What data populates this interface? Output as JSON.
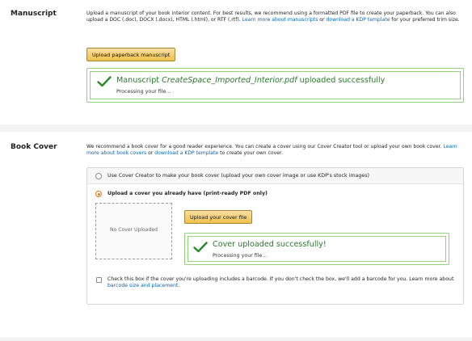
{
  "manuscript": {
    "title": "Manuscript",
    "description_text_1": "Upload a manuscript of your book interior content. For best results, we recommend using a formatted PDF file to create your paperback. You can also upload a DOC (.doc), DOCX (.docx), HTML (.html), or RTF (.rtf). ",
    "link_learn_more": "Learn more about manuscripts",
    "description_text_2": " or ",
    "link_template": "download a KDP template",
    "description_text_3": " for your preferred trim size.",
    "upload_button": "Upload paperback manuscript",
    "success_prefix": "Manuscript ",
    "success_filename": "CreateSpace_Imported_Interior.pdf",
    "success_suffix": " uploaded successfully",
    "processing": "Processing your file..."
  },
  "cover": {
    "title": "Book Cover",
    "description_text_1": "We recommend a book cover for a good reader experience. You can create a cover using our Cover Creator tool or upload your own book cover. ",
    "link_learn_more": "Learn more about book covers",
    "description_text_2": " or ",
    "link_template": "download a KDP template",
    "description_text_3": " to create your own cover.",
    "option_creator": "Use Cover Creator to make your book cover (upload your own cover image or use KDP's stock images)",
    "option_upload": "Upload a cover you already have (print-ready PDF only)",
    "placeholder": "No Cover Uploaded",
    "upload_button": "Upload your cover file",
    "success_title": "Cover uploaded successfully!",
    "processing": "Processing your file...",
    "barcode_text": "Check this box if the cover you're uploading includes a barcode. If you don't check the box, we'll add a barcode for you. Learn more about ",
    "barcode_link": "barcode size and placement",
    "barcode_end": "."
  },
  "colors": {
    "success_green": "#2a7a2a",
    "link_blue": "#0066c0",
    "button_yellow": "#f0c14b",
    "radio_orange": "#e47911"
  },
  "icons": [
    "checkmark-icon"
  ]
}
